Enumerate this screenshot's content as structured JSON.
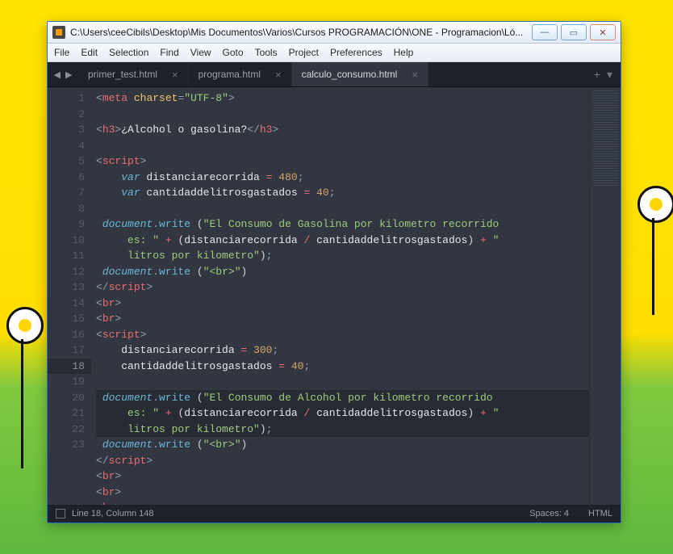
{
  "window": {
    "title": "C:\\Users\\ceeCibils\\Desktop\\Mis Documentos\\Varios\\Cursos PROGRAMACIÓN\\ONE - Programacion\\Ló..."
  },
  "menu": [
    "File",
    "Edit",
    "Selection",
    "Find",
    "View",
    "Goto",
    "Tools",
    "Project",
    "Preferences",
    "Help"
  ],
  "tabs": [
    {
      "label": "primer_test.html",
      "active": false
    },
    {
      "label": "programa.html",
      "active": false
    },
    {
      "label": "calculo_consumo.html",
      "active": true
    }
  ],
  "status": {
    "pos": "Line 18, Column 148",
    "spaces": "Spaces: 4",
    "syntax": "HTML"
  },
  "gutter": [
    "1",
    "2",
    "3",
    "4",
    "5",
    "6",
    "7",
    "8",
    "9",
    "",
    "",
    "10",
    "11",
    "12",
    "13",
    "14",
    "15",
    "16",
    "17",
    "18",
    "",
    "",
    "19",
    "20",
    "21",
    "22",
    "23"
  ],
  "highlight_lines": [
    19,
    20,
    21
  ],
  "code_tokens": [
    [
      {
        "c": "p",
        "t": "<"
      },
      {
        "c": "k",
        "t": "meta"
      },
      {
        "c": "w",
        "t": " "
      },
      {
        "c": "a",
        "t": "charset"
      },
      {
        "c": "p",
        "t": "="
      },
      {
        "c": "s",
        "t": "\"UTF-8\""
      },
      {
        "c": "p",
        "t": ">"
      }
    ],
    [],
    [
      {
        "c": "p",
        "t": "<"
      },
      {
        "c": "t",
        "t": "h3"
      },
      {
        "c": "p",
        "t": ">"
      },
      {
        "c": "w",
        "t": "¿Alcohol o gasolina?"
      },
      {
        "c": "p",
        "t": "</"
      },
      {
        "c": "t",
        "t": "h3"
      },
      {
        "c": "p",
        "t": ">"
      }
    ],
    [],
    [
      {
        "c": "p",
        "t": "<"
      },
      {
        "c": "t",
        "t": "script"
      },
      {
        "c": "p",
        "t": ">"
      }
    ],
    [
      {
        "c": "w",
        "t": "    "
      },
      {
        "c": "i",
        "t": "var"
      },
      {
        "c": "w",
        "t": " distanciarecorrida "
      },
      {
        "c": "t",
        "t": "="
      },
      {
        "c": "w",
        "t": " "
      },
      {
        "c": "n",
        "t": "480"
      },
      {
        "c": "p",
        "t": ";"
      }
    ],
    [
      {
        "c": "w",
        "t": "    "
      },
      {
        "c": "i",
        "t": "var"
      },
      {
        "c": "w",
        "t": " cantidaddelitrosgastados "
      },
      {
        "c": "t",
        "t": "="
      },
      {
        "c": "w",
        "t": " "
      },
      {
        "c": "n",
        "t": "40"
      },
      {
        "c": "p",
        "t": ";"
      }
    ],
    [],
    [
      {
        "c": "w",
        "t": " "
      },
      {
        "c": "i",
        "t": "document"
      },
      {
        "c": "p",
        "t": "."
      },
      {
        "c": "f",
        "t": "write"
      },
      {
        "c": "w",
        "t": " "
      },
      {
        "c": "b",
        "t": "("
      },
      {
        "c": "s",
        "t": "\"El Consumo de Gasolina por kilometro recorrido"
      }
    ],
    [
      {
        "c": "s",
        "t": "     es: \""
      },
      {
        "c": "w",
        "t": " "
      },
      {
        "c": "t",
        "t": "+"
      },
      {
        "c": "w",
        "t": " "
      },
      {
        "c": "b",
        "t": "("
      },
      {
        "c": "w",
        "t": "distanciarecorrida "
      },
      {
        "c": "t",
        "t": "/"
      },
      {
        "c": "w",
        "t": " cantidaddelitrosgastados"
      },
      {
        "c": "b",
        "t": ")"
      },
      {
        "c": "w",
        "t": " "
      },
      {
        "c": "t",
        "t": "+"
      },
      {
        "c": "w",
        "t": " "
      },
      {
        "c": "s",
        "t": "\""
      }
    ],
    [
      {
        "c": "s",
        "t": "     litros por kilometro\""
      },
      {
        "c": "b",
        "t": ")"
      },
      {
        "c": "p",
        "t": ";"
      }
    ],
    [
      {
        "c": "w",
        "t": " "
      },
      {
        "c": "i",
        "t": "document"
      },
      {
        "c": "p",
        "t": "."
      },
      {
        "c": "f",
        "t": "write"
      },
      {
        "c": "w",
        "t": " "
      },
      {
        "c": "b",
        "t": "("
      },
      {
        "c": "s",
        "t": "\"<br>\""
      },
      {
        "c": "b",
        "t": ")"
      }
    ],
    [
      {
        "c": "p",
        "t": "</"
      },
      {
        "c": "t",
        "t": "script"
      },
      {
        "c": "p",
        "t": ">"
      }
    ],
    [
      {
        "c": "p",
        "t": "<"
      },
      {
        "c": "t",
        "t": "br"
      },
      {
        "c": "p",
        "t": ">"
      }
    ],
    [
      {
        "c": "p",
        "t": "<"
      },
      {
        "c": "t",
        "t": "br"
      },
      {
        "c": "p",
        "t": ">"
      }
    ],
    [
      {
        "c": "p",
        "t": "<"
      },
      {
        "c": "t",
        "t": "script"
      },
      {
        "c": "p",
        "t": ">"
      }
    ],
    [
      {
        "c": "w",
        "t": "    distanciarecorrida "
      },
      {
        "c": "t",
        "t": "="
      },
      {
        "c": "w",
        "t": " "
      },
      {
        "c": "n",
        "t": "300"
      },
      {
        "c": "p",
        "t": ";"
      }
    ],
    [
      {
        "c": "w",
        "t": "    cantidaddelitrosgastados "
      },
      {
        "c": "t",
        "t": "="
      },
      {
        "c": "w",
        "t": " "
      },
      {
        "c": "n",
        "t": "40"
      },
      {
        "c": "p",
        "t": ";"
      }
    ],
    [],
    [
      {
        "c": "w",
        "t": " "
      },
      {
        "c": "i",
        "t": "document"
      },
      {
        "c": "p",
        "t": "."
      },
      {
        "c": "f",
        "t": "write"
      },
      {
        "c": "w",
        "t": " "
      },
      {
        "c": "b",
        "t": "("
      },
      {
        "c": "s",
        "t": "\"El Consumo de Alcohol por kilometro recorrido"
      }
    ],
    [
      {
        "c": "s",
        "t": "     es: \""
      },
      {
        "c": "w",
        "t": " "
      },
      {
        "c": "t",
        "t": "+"
      },
      {
        "c": "w",
        "t": " "
      },
      {
        "c": "b",
        "t": "("
      },
      {
        "c": "w",
        "t": "distanciarecorrida "
      },
      {
        "c": "t",
        "t": "/"
      },
      {
        "c": "w",
        "t": " cantidaddelitrosgastados"
      },
      {
        "c": "b",
        "t": ")"
      },
      {
        "c": "w",
        "t": " "
      },
      {
        "c": "t",
        "t": "+"
      },
      {
        "c": "w",
        "t": " "
      },
      {
        "c": "s",
        "t": "\""
      }
    ],
    [
      {
        "c": "s",
        "t": "     litros por kilometro\""
      },
      {
        "c": "b",
        "t": ")"
      },
      {
        "c": "p",
        "t": ";"
      }
    ],
    [
      {
        "c": "w",
        "t": " "
      },
      {
        "c": "i",
        "t": "document"
      },
      {
        "c": "p",
        "t": "."
      },
      {
        "c": "f",
        "t": "write"
      },
      {
        "c": "w",
        "t": " "
      },
      {
        "c": "b",
        "t": "("
      },
      {
        "c": "s",
        "t": "\"<br>\""
      },
      {
        "c": "b",
        "t": ")"
      }
    ],
    [
      {
        "c": "p",
        "t": "</"
      },
      {
        "c": "t",
        "t": "script"
      },
      {
        "c": "p",
        "t": ">"
      }
    ],
    [
      {
        "c": "p",
        "t": "<"
      },
      {
        "c": "t",
        "t": "br"
      },
      {
        "c": "p",
        "t": ">"
      }
    ],
    [
      {
        "c": "p",
        "t": "<"
      },
      {
        "c": "t",
        "t": "br"
      },
      {
        "c": "p",
        "t": ">"
      }
    ],
    [
      {
        "c": "p",
        "t": "<"
      },
      {
        "c": "t",
        "t": "br"
      },
      {
        "c": "p",
        "t": ">"
      }
    ]
  ]
}
